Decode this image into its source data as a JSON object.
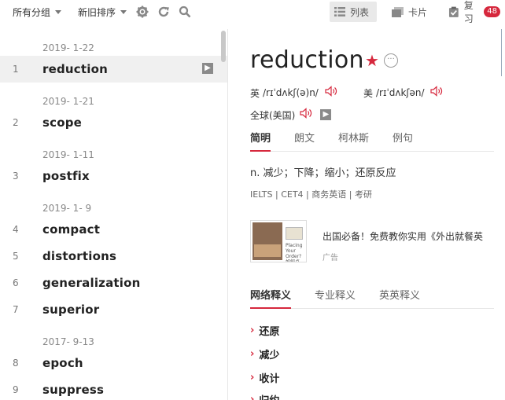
{
  "toolbar": {
    "group_label": "所有分组",
    "sort_label": "新旧排序",
    "view_list": "列表",
    "view_card": "卡片",
    "review": "复习",
    "review_count": "48"
  },
  "word_list": [
    {
      "type": "date",
      "text": "2019- 1-22"
    },
    {
      "type": "word",
      "index": "1",
      "word": "reduction",
      "selected": true
    },
    {
      "type": "date",
      "text": "2019- 1-21"
    },
    {
      "type": "word",
      "index": "2",
      "word": "scope"
    },
    {
      "type": "date",
      "text": "2019- 1-11"
    },
    {
      "type": "word",
      "index": "3",
      "word": "postfix"
    },
    {
      "type": "date",
      "text": "2019- 1- 9"
    },
    {
      "type": "word",
      "index": "4",
      "word": "compact"
    },
    {
      "type": "word",
      "index": "5",
      "word": "distortions"
    },
    {
      "type": "word",
      "index": "6",
      "word": "generalization"
    },
    {
      "type": "word",
      "index": "7",
      "word": "superior"
    },
    {
      "type": "date",
      "text": "2017- 9-13"
    },
    {
      "type": "word",
      "index": "8",
      "word": "epoch"
    },
    {
      "type": "word",
      "index": "9",
      "word": "suppress"
    }
  ],
  "detail": {
    "headword": "reduction",
    "uk_label": "英",
    "uk_phonetic": "/rɪˈdʌkʃ(ə)n/",
    "us_label": "美",
    "us_phonetic": "/rɪˈdʌkʃən/",
    "global_label": "全球(美国)",
    "tabs": [
      "简明",
      "朗文",
      "柯林斯",
      "例句"
    ],
    "definition": "n. 减少；下降；缩小；还原反应",
    "tags": "IELTS | CET4 | 商务英语 | 考研",
    "ad_title": "出国必备！免费教你实用《外出就餐英",
    "ad_label": "广告",
    "ad_image_text": "Placing Your Order? 如何点菜?",
    "tabs2": [
      "网络释义",
      "专业释义",
      "英英释义"
    ],
    "senses": [
      "还原",
      "减少",
      "收计",
      "归约"
    ]
  },
  "colors": {
    "accent": "#d6283d",
    "selected_row": "#f0f0f0"
  }
}
